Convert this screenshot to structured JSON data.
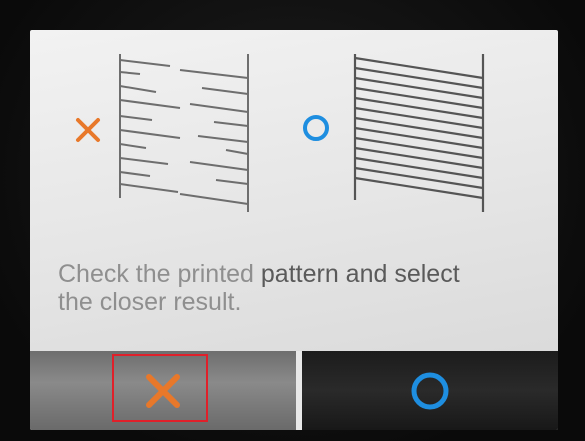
{
  "message": {
    "part1": "Check the printed ",
    "part2": "pattern and select",
    "part3": "the closer result."
  },
  "buttons": {
    "ng_icon": "cross-icon",
    "ok_icon": "circle-icon"
  },
  "illustration": {
    "ng_icon": "cross-icon",
    "ok_icon": "circle-icon"
  },
  "colors": {
    "cross": "#e8782a",
    "circle": "#1e8ee0",
    "highlight": "#e0202a"
  }
}
